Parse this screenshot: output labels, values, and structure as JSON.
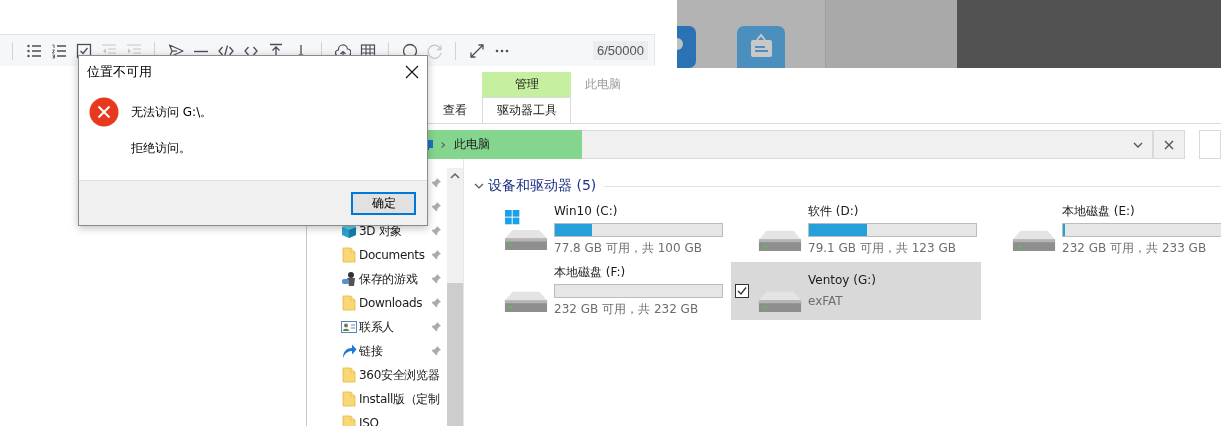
{
  "editor": {
    "toolbar_groups": [
      [
        {
          "kind": "bullets",
          "disabled": false
        },
        {
          "kind": "numbers",
          "disabled": false
        },
        {
          "kind": "checklist",
          "disabled": false
        },
        {
          "kind": "outdent",
          "disabled": true
        },
        {
          "kind": "indent",
          "disabled": true
        }
      ],
      [
        {
          "kind": "send",
          "disabled": false
        },
        {
          "kind": "rule",
          "disabled": false
        },
        {
          "kind": "code",
          "disabled": false
        },
        {
          "kind": "brackets",
          "disabled": false
        },
        {
          "kind": "top",
          "disabled": false
        },
        {
          "kind": "down",
          "disabled": false
        }
      ],
      [
        {
          "kind": "upload",
          "disabled": false
        },
        {
          "kind": "table",
          "disabled": false
        }
      ],
      [
        {
          "kind": "circle",
          "disabled": false
        },
        {
          "kind": "redo",
          "disabled": true
        }
      ],
      [
        {
          "kind": "expand",
          "disabled": false
        },
        {
          "kind": "more",
          "disabled": false
        }
      ]
    ],
    "counter": "6/50000"
  },
  "explorer": {
    "ribbon": {
      "context_tab": "管理",
      "context_title": "此电脑",
      "tabs": [
        {
          "label": "查看",
          "selected": false
        },
        {
          "label": "驱动器工具",
          "selected": true
        }
      ]
    },
    "address": {
      "path": "此电脑"
    },
    "nav_items": [
      {
        "pinned": true
      },
      {
        "pinned": true
      },
      {
        "label": "3D 对象",
        "kind": "cube",
        "pinned": true
      },
      {
        "label": "Documents",
        "kind": "folder",
        "pinned": true
      },
      {
        "label": "保存的游戏",
        "kind": "games",
        "pinned": true
      },
      {
        "label": "Downloads",
        "kind": "folder",
        "pinned": true
      },
      {
        "label": "联系人",
        "kind": "contacts",
        "pinned": true
      },
      {
        "label": "链接",
        "kind": "links",
        "pinned": true
      },
      {
        "label": "360安全浏览器",
        "kind": "folder",
        "pinned": false
      },
      {
        "label": "Install版（定制",
        "kind": "folder",
        "pinned": false
      },
      {
        "label": "ISO",
        "kind": "folder",
        "pinned": false
      }
    ],
    "section": {
      "title": "设备和驱动器 (5)",
      "expanded": true
    },
    "drives": [
      {
        "name": "Win10 (C:)",
        "kind": "system",
        "level": 0.22,
        "info": "77.8 GB 可用，共 100 GB",
        "selected": false
      },
      {
        "name": "软件 (D:)",
        "kind": "disk",
        "level": 0.35,
        "info": "79.1 GB 可用，共 123 GB",
        "selected": false
      },
      {
        "name": "本地磁盘 (E:)",
        "kind": "disk",
        "level": 0.01,
        "info": "232 GB 可用，共 233 GB",
        "selected": false
      },
      {
        "name": "本地磁盘 (F:)",
        "kind": "disk",
        "level": 0.0,
        "info": "232 GB 可用，共 232 GB",
        "selected": false
      },
      {
        "name": "Ventoy (G:)",
        "kind": "disk",
        "info": "exFAT",
        "selected": true
      }
    ]
  },
  "dialog": {
    "title": "位置不可用",
    "message": "无法访问 G:\\。",
    "detail": "拒绝访问。",
    "button": "确定"
  }
}
